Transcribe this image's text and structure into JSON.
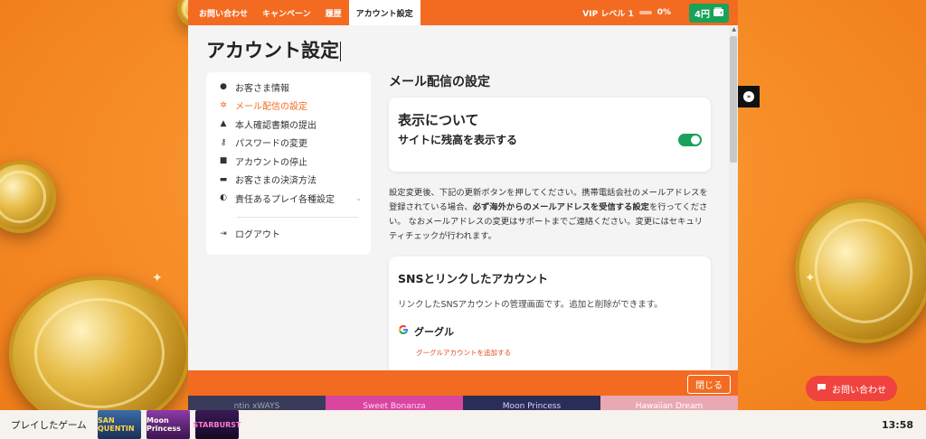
{
  "topnav": {
    "items": [
      "お問い合わせ",
      "キャンペーン",
      "履歴",
      "アカウント設定"
    ],
    "active_index": 3,
    "vip_label": "VIP レベル 1",
    "vip_percent": "0%",
    "balance": "4円"
  },
  "page": {
    "title": "アカウント設定"
  },
  "sidebar": {
    "items": [
      {
        "label": "お客さま情報",
        "icon": "user-icon"
      },
      {
        "label": "メール配信の設定",
        "icon": "gear-icon",
        "active": true
      },
      {
        "label": "本人確認書類の提出",
        "icon": "user-id-icon"
      },
      {
        "label": "パスワードの変更",
        "icon": "key-icon"
      },
      {
        "label": "アカウントの停止",
        "icon": "lock-icon"
      },
      {
        "label": "お客さまの決済方法",
        "icon": "card-icon"
      },
      {
        "label": "責任あるプレイ各種設定",
        "icon": "half-circle-icon"
      }
    ],
    "logout": "ログアウト"
  },
  "email_settings": {
    "title": "メール配信の設定",
    "display_card": {
      "heading": "表示について",
      "toggle_label": "サイトに残高を表示する",
      "toggle_on": true
    },
    "notice_part1": "設定変更後、下記の更新ボタンを押してください。携帯電話会社のメールアドレスを登録されている場合、",
    "notice_bold": "必ず海外からのメールアドレスを受信する設定",
    "notice_part2": "を行ってください。 なおメールアドレスの変更はサポートまでご連絡ください。変更にはセキュリティチェックが行われます。"
  },
  "sns": {
    "title": "SNSとリンクしたアカウント",
    "description": "リンクしたSNSアカウントの管理画面です。追加と削除ができます。",
    "google_label": "グーグル",
    "google_add": "グーグルアカウントを追加する"
  },
  "footer": {
    "close": "閉じる"
  },
  "floating": {
    "contact": "お問い合わせ"
  },
  "game_strip": [
    "ntin xWAYS",
    "Sweet Bonanza",
    "Moon Princess",
    "Hawaiian Dream"
  ],
  "bottom_bar": {
    "played_label": "プレイしたゲーム",
    "thumbs": [
      "SAN QUENTIN",
      "Moon Princess",
      "STARBURST"
    ],
    "clock": "13:58"
  },
  "colors": {
    "brand": "#f36b21",
    "toggle": "#1aa15a",
    "contact": "#f0433f"
  }
}
